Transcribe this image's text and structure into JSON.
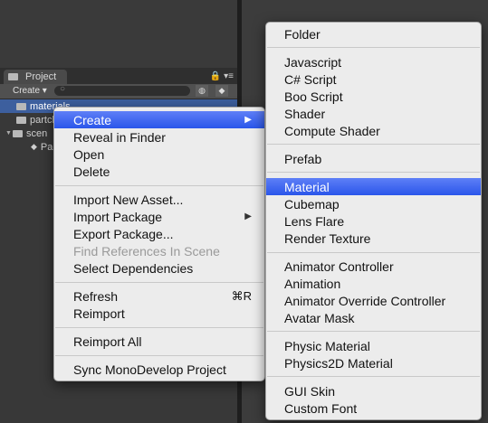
{
  "project_panel": {
    "tab_label": "Project",
    "create_label": "Create ▾",
    "tab_icon_lock": "🔒",
    "tab_icon_menu": "▾≡",
    "tree": [
      {
        "label": "materials",
        "selected": true
      },
      {
        "label": "partcl"
      },
      {
        "label": "scen"
      },
      {
        "label": "Pa"
      }
    ]
  },
  "context_menu": {
    "items": [
      {
        "label": "Create",
        "submenu": true
      },
      {
        "label": "Reveal in Finder"
      },
      {
        "label": "Open"
      },
      {
        "label": "Delete"
      },
      {
        "label": "Import New Asset..."
      },
      {
        "label": "Import Package",
        "submenu": true
      },
      {
        "label": "Export Package..."
      },
      {
        "label": "Find References In Scene",
        "disabled": true
      },
      {
        "label": "Select Dependencies"
      },
      {
        "label": "Refresh",
        "shortcut": "⌘R"
      },
      {
        "label": "Reimport"
      },
      {
        "label": "Reimport All"
      },
      {
        "label": "Sync MonoDevelop Project"
      }
    ]
  },
  "create_submenu": {
    "items": [
      {
        "label": "Folder"
      },
      {
        "label": "Javascript"
      },
      {
        "label": "C# Script"
      },
      {
        "label": "Boo Script"
      },
      {
        "label": "Shader"
      },
      {
        "label": "Compute Shader"
      },
      {
        "label": "Prefab"
      },
      {
        "label": "Material",
        "highlighted": true
      },
      {
        "label": "Cubemap"
      },
      {
        "label": "Lens Flare"
      },
      {
        "label": "Render Texture"
      },
      {
        "label": "Animator Controller"
      },
      {
        "label": "Animation"
      },
      {
        "label": "Animator Override Controller"
      },
      {
        "label": "Avatar Mask"
      },
      {
        "label": "Physic Material"
      },
      {
        "label": "Physics2D Material"
      },
      {
        "label": "GUI Skin"
      },
      {
        "label": "Custom Font"
      }
    ]
  },
  "colors": {
    "highlight": "#2a56ea",
    "menu_bg": "#ececec",
    "editor_bg": "#383838"
  }
}
